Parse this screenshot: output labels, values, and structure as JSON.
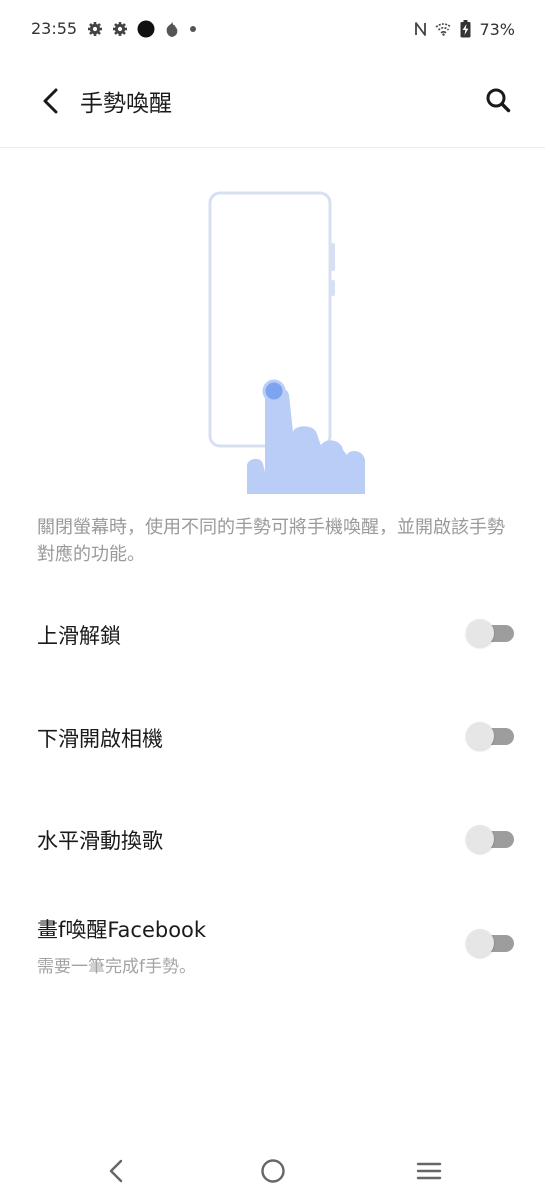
{
  "status_bar": {
    "time": "23:55",
    "battery": "73%",
    "left_icons": [
      "gear-icon",
      "gear-icon",
      "dot-icon",
      "flame-icon",
      "small-dot-icon"
    ],
    "right_icons": [
      "nfc-icon",
      "wifi-icon",
      "battery-charging-icon"
    ]
  },
  "app_bar": {
    "title": "手勢喚醒",
    "back_icon": "back-arrow-icon",
    "search_icon": "search-icon"
  },
  "illustration": {
    "name": "phone-tap-gesture-illustration",
    "accent_color": "#b9cdf6",
    "dot_color": "#7ea3ef",
    "frame_color": "#d7e0f3"
  },
  "description": "關閉螢幕時，使用不同的手勢可將手機喚醒，並開啟該手勢對應的功能。",
  "settings": [
    {
      "label": "上滑解鎖",
      "enabled": false
    },
    {
      "label": "下滑開啟相機",
      "enabled": false
    },
    {
      "label": "水平滑動換歌",
      "enabled": false
    },
    {
      "label": "畫f喚醒Facebook",
      "subtitle": "需要一筆完成f手勢。",
      "enabled": false
    }
  ],
  "nav_bar": {
    "back_icon": "nav-back-icon",
    "home_icon": "nav-home-icon",
    "recents_icon": "nav-menu-icon"
  }
}
